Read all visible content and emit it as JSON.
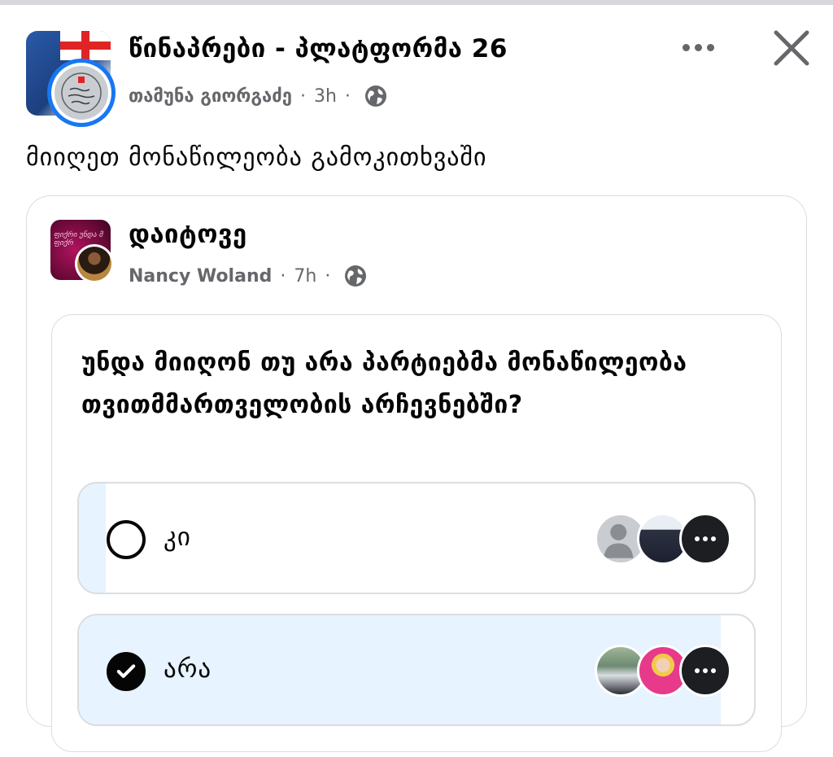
{
  "post": {
    "page_name": "წინაპრები - პლატფორმა 26",
    "author": "თამუნა გიორგაძე",
    "time": "3h",
    "separator": "·",
    "text": "მიიღეთ მონაწილეობა გამოკითხვაში",
    "avatar_icon": "platform-logo-avatar",
    "privacy_icon": "globe-icon"
  },
  "header_actions": {
    "more_icon": "more-horizontal-icon",
    "close_icon": "close-icon"
  },
  "shared": {
    "name": "დაიტოვე",
    "author": "Nancy Woland",
    "time": "7h",
    "separator": "·",
    "privacy_icon": "globe-icon"
  },
  "poll": {
    "question": "უნდა მიიღონ თუ არა პარტიებმა მონაწილეობა თვითმმართველობის არჩევნებში?",
    "options": [
      {
        "label": "კი",
        "selected": false,
        "fill_fraction": 0.04
      },
      {
        "label": "არა",
        "selected": true,
        "fill_fraction": 0.95
      }
    ]
  },
  "colors": {
    "accent": "#1877f2",
    "poll_fill": "#e7f3ff",
    "secondary_text": "#65676b",
    "border": "#dadde1"
  }
}
